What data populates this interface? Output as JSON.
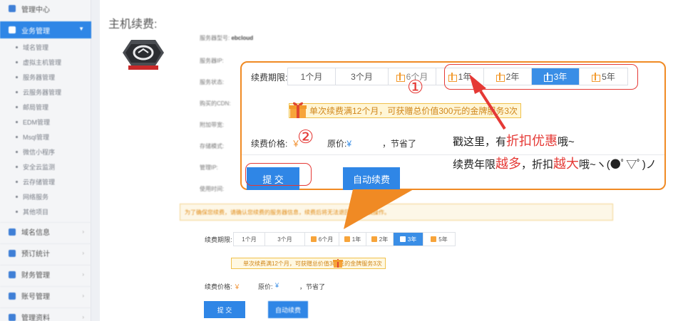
{
  "sidebar": {
    "top_item": "管理中心",
    "active_item": "业务管理",
    "sub_items": [
      "域名管理",
      "虚拟主机管理",
      "服务器管理",
      "云服务器管理",
      "邮局管理",
      "EDM管理",
      "Msql管理",
      "微信小程序",
      "安全云监测",
      "云存储管理",
      "网络服务",
      "其他项目"
    ],
    "groups": [
      "域名信息",
      "预订统计",
      "财务管理",
      "账号管理",
      "管理资料"
    ]
  },
  "page": {
    "title": "主机续费:",
    "info_rows": [
      {
        "label": "服务器型号:",
        "value": "ebcloud"
      },
      {
        "label": "服务器IP:",
        "value": ""
      },
      {
        "label": "服务状态:",
        "value": ""
      },
      {
        "label": "购买的CDN:",
        "value": ""
      },
      {
        "label": "附加带宽:",
        "value": ""
      },
      {
        "label": "存储模式:",
        "value": ""
      },
      {
        "label": "管理IP:",
        "value": ""
      },
      {
        "label": "使用时间:",
        "value": ""
      }
    ],
    "notice": "为了确保您续费，请确认您续费的服务器信息，续费后将无法退回，请谨慎操作。"
  },
  "renew_form": {
    "period_label": "续费期限:",
    "periods": [
      {
        "label": "1个月",
        "gift": false
      },
      {
        "label": "3个月",
        "gift": false
      },
      {
        "label": "6个月",
        "gift": true
      },
      {
        "label": "1年",
        "gift": true
      },
      {
        "label": "2年",
        "gift": true
      },
      {
        "label": "3年",
        "gift": true
      },
      {
        "label": "5年",
        "gift": true
      }
    ],
    "selected_period": "3年",
    "promo_text": "单次续费满12个月，可获赠总价值300元的金牌服务3次",
    "price_label": "续费价格:",
    "price_symbol": "￥",
    "original_label": "原价:",
    "original_value": "¥",
    "saved_text": "，节省了",
    "submit_label": "提 交",
    "auto_renew_label": "自动续费"
  },
  "annotations": {
    "mark_1": "①",
    "mark_2": "②",
    "note_line1_prefix": "戳这里，有",
    "note_line1_highlight": "折扣优惠",
    "note_line1_suffix": "哦~",
    "note_line2_prefix": "续费年限",
    "note_line2_highlight1": "越多",
    "note_line2_middle": "，折扣",
    "note_line2_highlight2": "越大",
    "note_line2_suffix": "哦~ヽ(●ﾟ▽ﾟ)ノ"
  },
  "colors": {
    "primary": "#2f86e6",
    "callout_border": "#f08a24",
    "highlight": "#e53935",
    "promo": "#d0861a"
  }
}
